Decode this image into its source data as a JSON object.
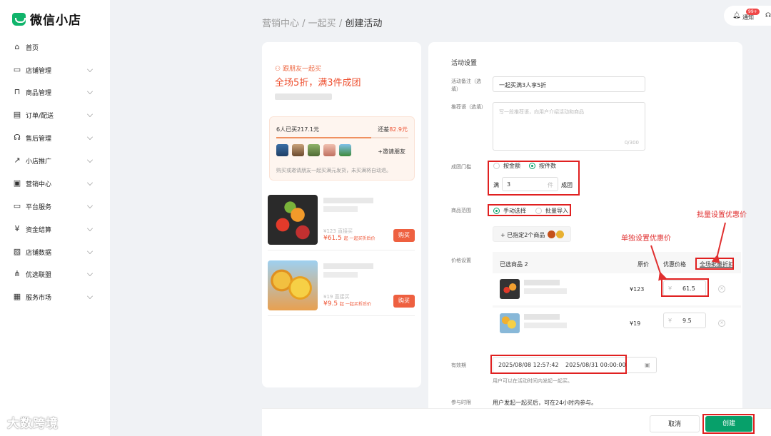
{
  "app": {
    "title": "微信小店"
  },
  "sidebar": {
    "items": [
      {
        "label": "首页",
        "icon": "home-icon",
        "glyph": "⌂",
        "has_children": false
      },
      {
        "label": "店铺管理",
        "icon": "store-icon",
        "glyph": "▭",
        "has_children": true
      },
      {
        "label": "商品管理",
        "icon": "bag-icon",
        "glyph": "⊓",
        "has_children": true
      },
      {
        "label": "订单/配送",
        "icon": "order-icon",
        "glyph": "▤",
        "has_children": true
      },
      {
        "label": "售后管理",
        "icon": "headset-icon",
        "glyph": "☊",
        "has_children": true
      },
      {
        "label": "小店推广",
        "icon": "chart-icon",
        "glyph": "↗",
        "has_children": true
      },
      {
        "label": "营销中心",
        "icon": "ticket-icon",
        "glyph": "▣",
        "has_children": true
      },
      {
        "label": "平台服务",
        "icon": "service-icon",
        "glyph": "▭",
        "has_children": true
      },
      {
        "label": "资金结算",
        "icon": "yen-icon",
        "glyph": "¥",
        "has_children": true
      },
      {
        "label": "店铺数据",
        "icon": "data-icon",
        "glyph": "▨",
        "has_children": true
      },
      {
        "label": "优选联盟",
        "icon": "network-icon",
        "glyph": "⋔",
        "has_children": true
      },
      {
        "label": "服务市场",
        "icon": "market-icon",
        "glyph": "▦",
        "has_children": true
      }
    ]
  },
  "breadcrumb": {
    "l1": "营销中心",
    "sep": " / ",
    "l2": "一起买",
    "l3": "创建活动"
  },
  "topbar": {
    "notice_label": "通知",
    "badge": "99+"
  },
  "preview": {
    "header": "跟朋友一起买",
    "title": "全场5折，满3件成团",
    "progress_left": "6人已买217.1元",
    "progress_right_prefix": "还差",
    "progress_right_amount": "82.9元",
    "progress_fraction": 0.72,
    "invite": "+邀请朋友",
    "tip": "购买或邀请朋友一起买满元发货，未买满将自动退。",
    "products": [
      {
        "orig_price": "¥123",
        "orig_note": "直接买",
        "new_price": "¥61.5",
        "new_note": "起 一起买折后价",
        "buy": "购买"
      },
      {
        "orig_price": "¥19",
        "orig_note": "直接买",
        "new_price": "¥9.5",
        "new_note": "起 一起买折后价",
        "buy": "购买"
      }
    ]
  },
  "settings": {
    "section_title": "活动设置",
    "remark": {
      "label": "活动备注（选填）",
      "value": "一起买满3人享5折"
    },
    "recommend": {
      "label": "推荐语（选填）",
      "placeholder": "写一段推荐语，向用户介绍活动和商品",
      "counter": "0/300"
    },
    "threshold": {
      "label": "成团门槛",
      "opt1": "按金额",
      "opt2": "按件数",
      "selected": "按件数",
      "prefix": "满",
      "value": "3",
      "unit": "件",
      "suffix": "成团"
    },
    "scope": {
      "label": "商品范围",
      "opt1": "手动选择",
      "opt2": "批量导入",
      "selected": "手动选择",
      "selected_btn": "+ 已指定2个商品"
    },
    "price": {
      "label": "价格设置",
      "col_selected": "已选商品 2",
      "col_orig": "原价",
      "col_discount": "优惠价格",
      "col_batch": "全场批量折扣",
      "rows": [
        {
          "orig": "¥123",
          "currency": "¥",
          "discount": "61.5"
        },
        {
          "orig": "¥19",
          "currency": "¥",
          "discount": "9.5"
        }
      ]
    },
    "validity": {
      "label": "有效期",
      "start": "2025/08/08 12:57:42",
      "end": "2025/08/31 00:00:00",
      "hint": "用户可以在活动时间内发起一起买。"
    },
    "join": {
      "label": "参与时限",
      "text": "用户发起一起买后，可在24小时内参与。"
    }
  },
  "annotations": {
    "single": "单独设置优惠价",
    "batch": "批量设置优惠价"
  },
  "footer": {
    "cancel": "取消",
    "create": "创建"
  },
  "watermark": "大数跨境",
  "colors": {
    "brand_green": "#07a06a",
    "accent_red": "#e02020",
    "price_orange": "#ee5030"
  }
}
